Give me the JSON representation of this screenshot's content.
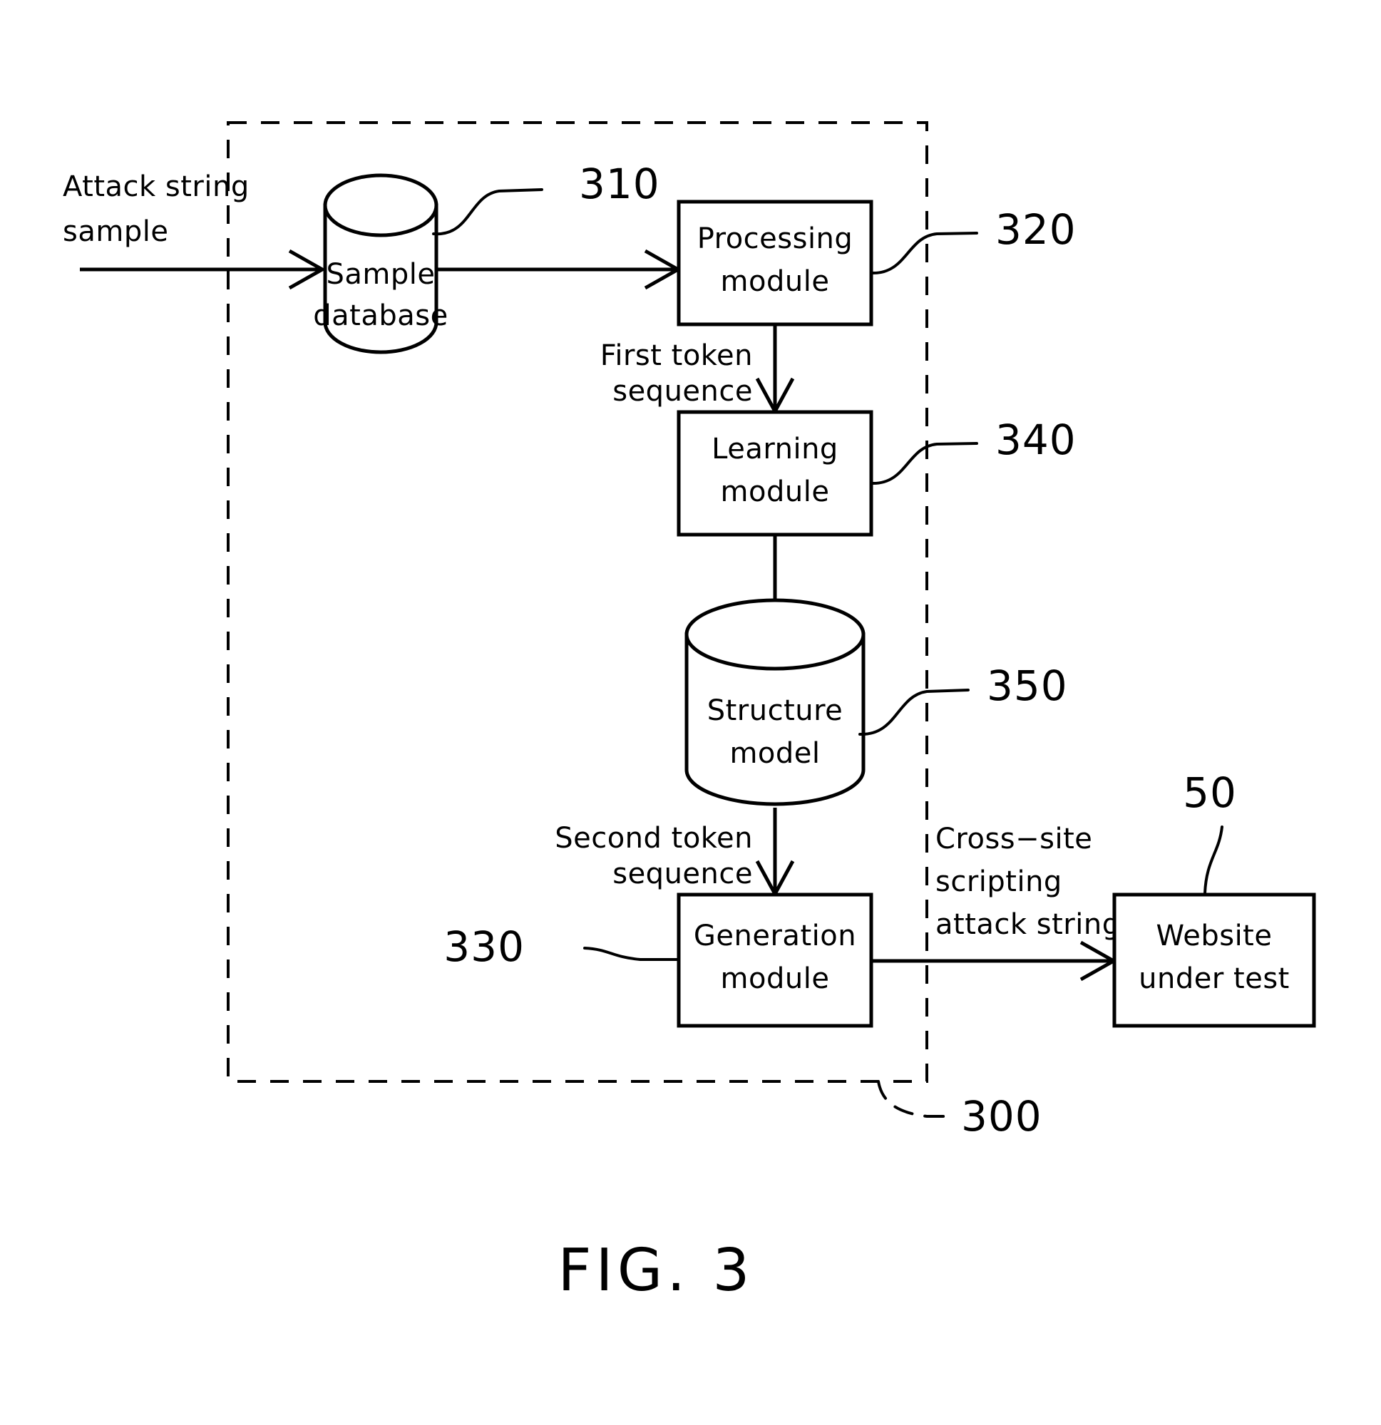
{
  "figure": {
    "caption": "FIG. 3",
    "nodes": {
      "sample_database": {
        "line1": "Sample",
        "line2": "database",
        "ref": "310",
        "shape": "cylinder"
      },
      "processing_module": {
        "line1": "Processing",
        "line2": "module",
        "ref": "320",
        "shape": "rect"
      },
      "learning_module": {
        "line1": "Learning",
        "line2": "module",
        "ref": "340",
        "shape": "rect"
      },
      "structure_model": {
        "line1": "Structure",
        "line2": "model",
        "ref": "350",
        "shape": "cylinder"
      },
      "generation_module": {
        "line1": "Generation",
        "line2": "module",
        "ref": "330",
        "shape": "rect"
      },
      "website_under_test": {
        "line1": "Website",
        "line2": "under  test",
        "ref": "50",
        "shape": "rect"
      }
    },
    "system_boundary": {
      "ref": "300",
      "style": "dashed"
    },
    "edges": {
      "input": {
        "line1": "Attack  string",
        "line2": "sample"
      },
      "processing_to_learning": {
        "line1": "First  token",
        "line2": "sequence"
      },
      "model_to_generation": {
        "line1": "Second  token",
        "line2": "sequence"
      },
      "generation_to_website": {
        "line1": "Cross−site",
        "line2": "scripting",
        "line3": "attack  string"
      }
    }
  }
}
